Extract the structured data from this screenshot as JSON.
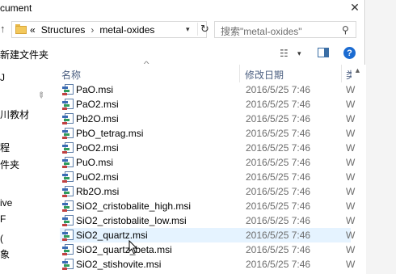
{
  "title": "cument",
  "address": {
    "prefix": "«",
    "crumbs": [
      "Structures",
      "metal-oxides"
    ],
    "separator": "›"
  },
  "search": {
    "placeholder": "搜索\"metal-oxides\""
  },
  "toolbar": {
    "new_folder": "新建文件夹"
  },
  "nav": [
    "",
    "",
    "",
    "",
    "",
    "",
    "",
    ""
  ],
  "nav_labels": {
    "n0": "J",
    "n1": "川教材",
    "n2": "程",
    "n3": "件夹",
    "n4": "ive",
    "n5": "F",
    "n6": "(",
    "n7": "象"
  },
  "columns": {
    "name": "名称",
    "date": "修改日期",
    "type": "类"
  },
  "files": [
    {
      "name": "PaO.msi",
      "date": "2016/5/25 7:46",
      "type": "W"
    },
    {
      "name": "PaO2.msi",
      "date": "2016/5/25 7:46",
      "type": "W"
    },
    {
      "name": "Pb2O.msi",
      "date": "2016/5/25 7:46",
      "type": "W"
    },
    {
      "name": "PbO_tetrag.msi",
      "date": "2016/5/25 7:46",
      "type": "W"
    },
    {
      "name": "PoO2.msi",
      "date": "2016/5/25 7:46",
      "type": "W"
    },
    {
      "name": "PuO.msi",
      "date": "2016/5/25 7:46",
      "type": "W"
    },
    {
      "name": "PuO2.msi",
      "date": "2016/5/25 7:46",
      "type": "W"
    },
    {
      "name": "Rb2O.msi",
      "date": "2016/5/25 7:46",
      "type": "W"
    },
    {
      "name": "SiO2_cristobalite_high.msi",
      "date": "2016/5/25 7:46",
      "type": "W"
    },
    {
      "name": "SiO2_cristobalite_low.msi",
      "date": "2016/5/25 7:46",
      "type": "W"
    },
    {
      "name": "SiO2_quartz.msi",
      "date": "2016/5/25 7:46",
      "type": "W"
    },
    {
      "name": "SiO2_quartz_beta.msi",
      "date": "2016/5/25 7:46",
      "type": "W"
    },
    {
      "name": "SiO2_stishovite.msi",
      "date": "2016/5/25 7:46",
      "type": "W"
    }
  ],
  "selected_file": "SiO2_quartz.msi",
  "colors": {
    "selection": "#e5f3ff",
    "help": "#1b6bd1",
    "header_text": "#4d6082"
  }
}
